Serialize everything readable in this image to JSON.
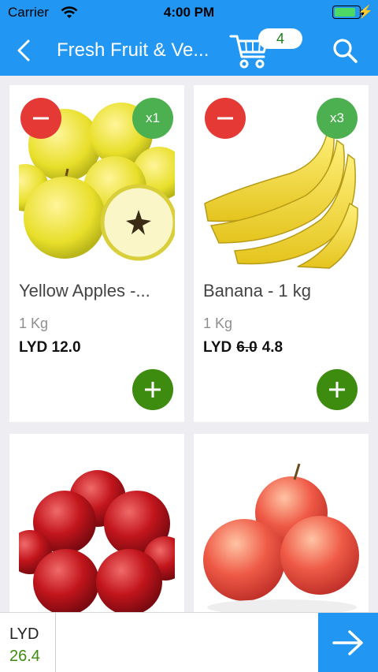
{
  "status_bar": {
    "carrier": "Carrier",
    "time": "4:00 PM",
    "battery_level": 0.85,
    "battery_color": "#4cd964"
  },
  "nav": {
    "back_icon": "chevron-left-icon",
    "title": "Fresh Fruit  & Ve...",
    "cart_icon": "shopping-cart-icon",
    "cart_count": "4",
    "search_icon": "search-icon",
    "bar_color": "#2196f3"
  },
  "products": [
    {
      "name": "Yellow Apples  -...",
      "unit": "1 Kg",
      "currency": "LYD",
      "price": "12.0",
      "quantity_badge": "x1",
      "image": "yellow-apples"
    },
    {
      "name": "Banana - 1 kg",
      "unit": "1 Kg",
      "currency": "LYD",
      "old_price": "6.0",
      "price": "4.8",
      "quantity_badge": "x3",
      "image": "bananas"
    },
    {
      "image": "red-apples"
    },
    {
      "image": "pink-apples"
    }
  ],
  "colors": {
    "remove_button": "#e53935",
    "quantity_badge": "#4caf50",
    "add_button": "#3d8c10",
    "total_text": "#3d8c10"
  },
  "footer": {
    "currency": "LYD",
    "total": "26.4",
    "next_icon": "arrow-right-icon"
  }
}
